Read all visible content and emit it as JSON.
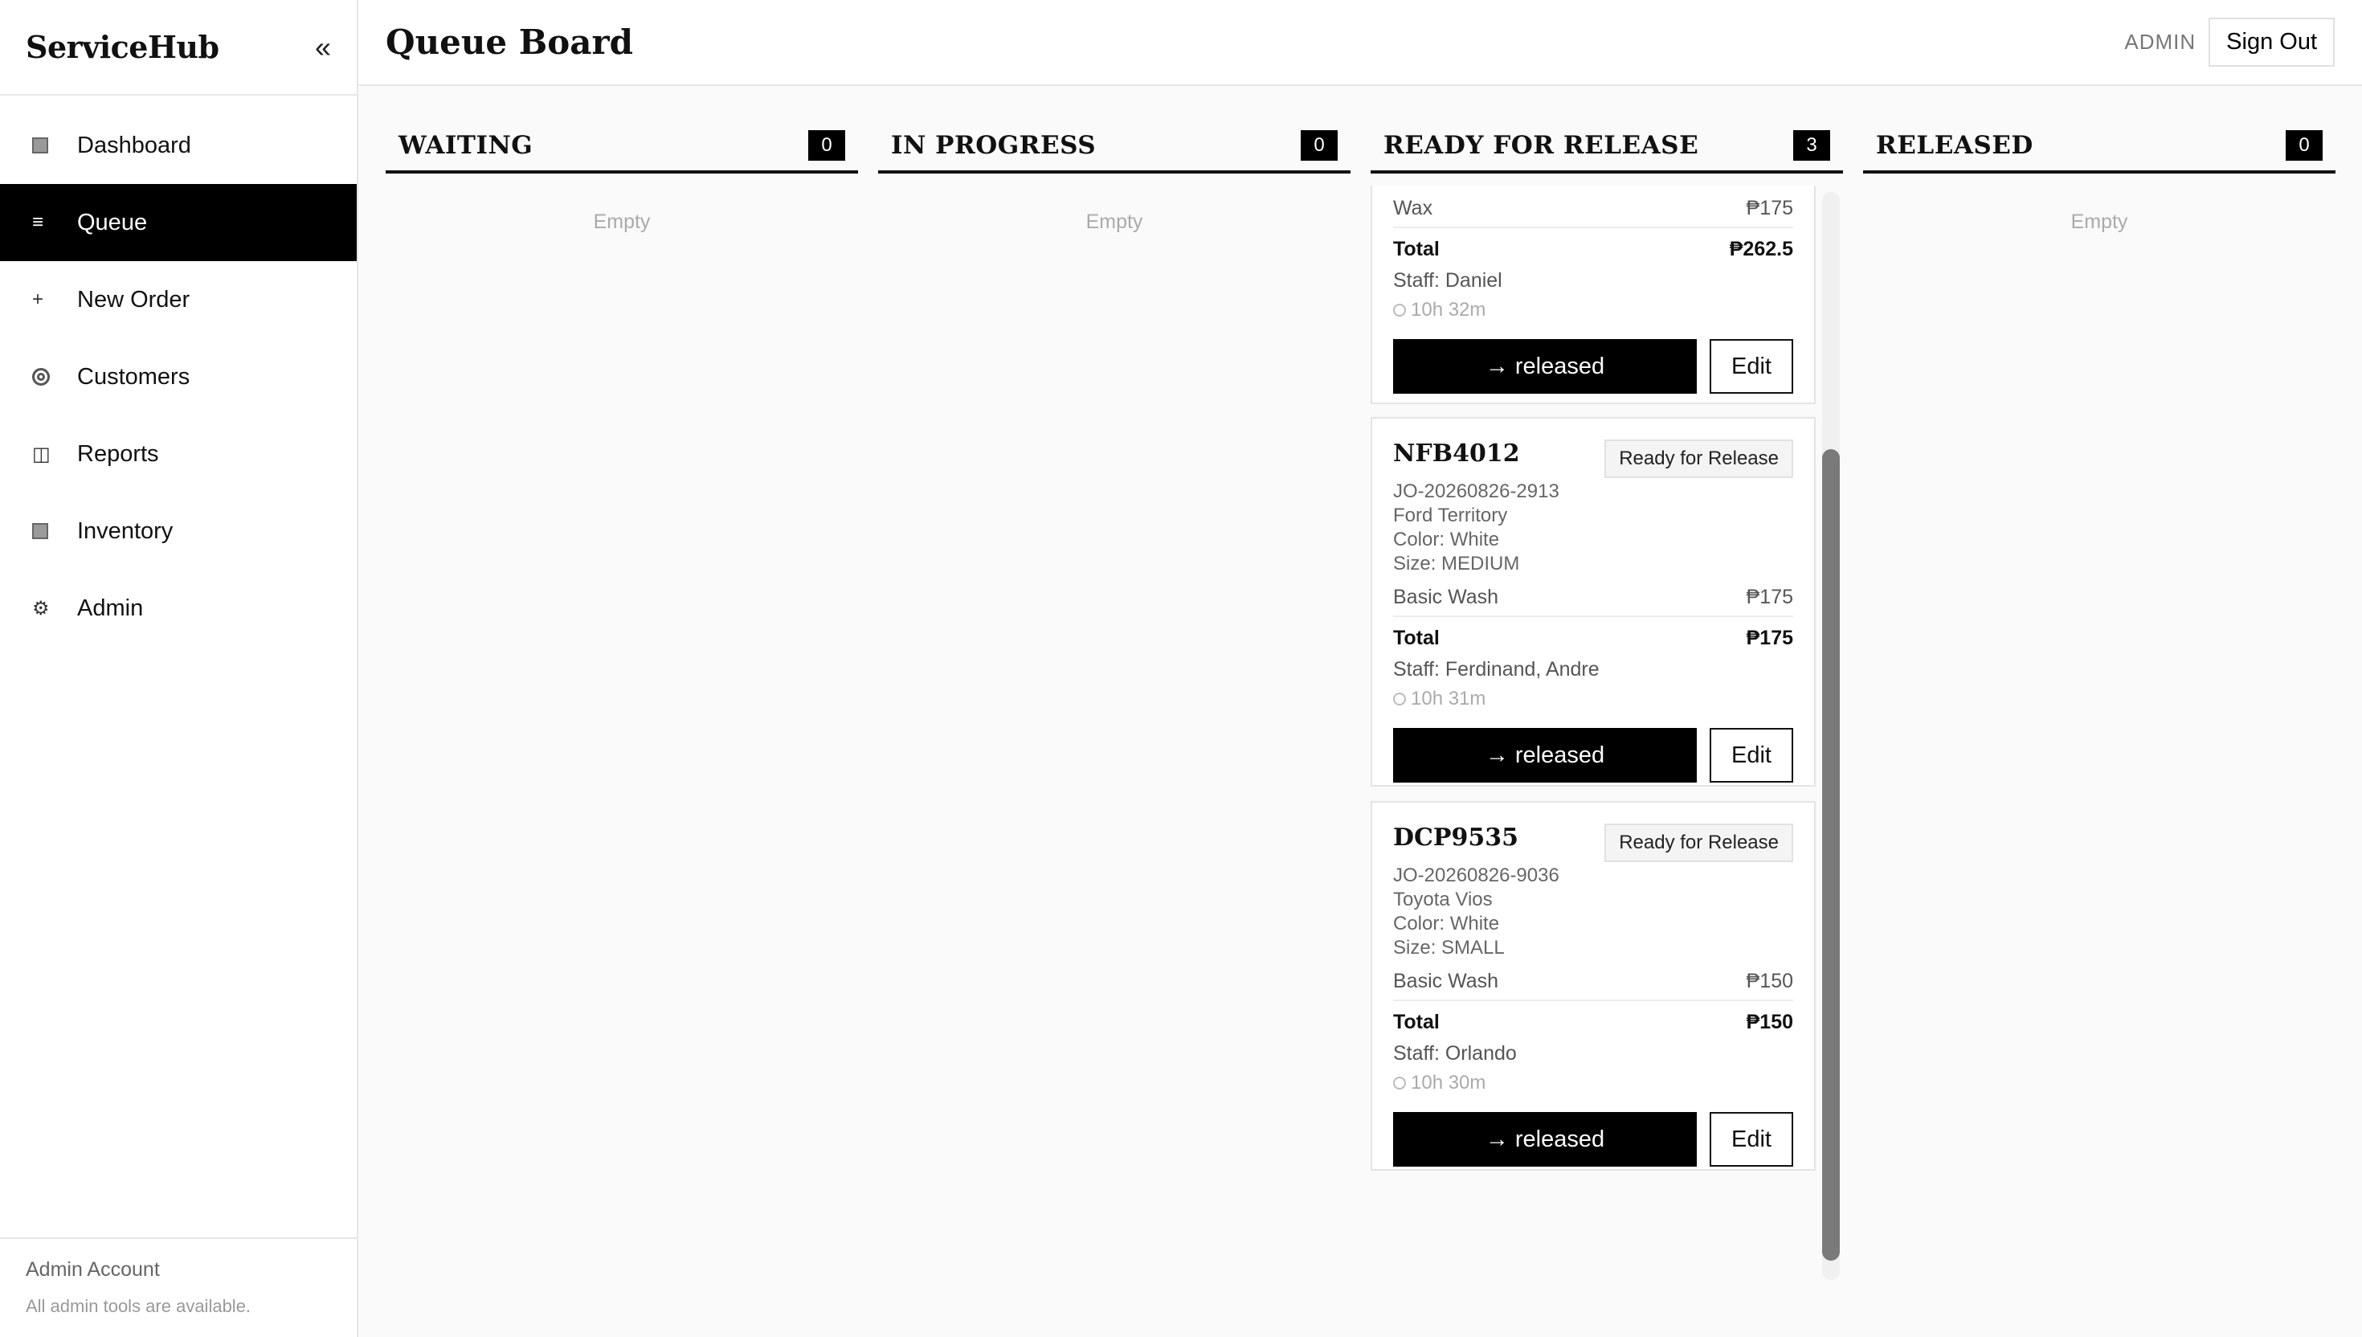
{
  "sidebar": {
    "brand": "ServiceHub",
    "collapse_icon": "«",
    "items": [
      {
        "label": "Dashboard",
        "icon": "dashboard-icon"
      },
      {
        "label": "Queue",
        "icon": "queue-icon",
        "active": true
      },
      {
        "label": "New Order",
        "icon": "plus-icon"
      },
      {
        "label": "Customers",
        "icon": "customers-icon"
      },
      {
        "label": "Reports",
        "icon": "reports-icon"
      },
      {
        "label": "Inventory",
        "icon": "inventory-icon"
      },
      {
        "label": "Admin",
        "icon": "gear-icon"
      }
    ],
    "footer": {
      "title": "Admin Account",
      "subtitle": "All admin tools are available."
    }
  },
  "header": {
    "title": "Queue Board",
    "role": "ADMIN",
    "sign_out": "Sign Out"
  },
  "columns": [
    {
      "title": "WAITING",
      "count": "0",
      "empty": "Empty"
    },
    {
      "title": "IN PROGRESS",
      "count": "0",
      "empty": "Empty"
    },
    {
      "title": "READY FOR RELEASE",
      "count": "3"
    },
    {
      "title": "RELEASED",
      "count": "0",
      "empty": "Empty"
    }
  ],
  "cards": [
    {
      "service": "Wax",
      "service_price": "₱175",
      "total_label": "Total",
      "total": "₱262.5",
      "staff": "Staff: Daniel",
      "elapsed": "10h 32m",
      "release_label": "→ released",
      "edit_label": "Edit"
    },
    {
      "plate": "NFB4012",
      "status": "Ready for Release",
      "job_order": "JO-20260826-2913",
      "vehicle": "Ford Territory",
      "color": "Color: White",
      "size": "Size: MEDIUM",
      "service": "Basic Wash",
      "service_price": "₱175",
      "total_label": "Total",
      "total": "₱175",
      "staff": "Staff: Ferdinand, Andre",
      "elapsed": "10h 31m",
      "release_label": "→ released",
      "edit_label": "Edit"
    },
    {
      "plate": "DCP9535",
      "status": "Ready for Release",
      "job_order": "JO-20260826-9036",
      "vehicle": "Toyota Vios",
      "color": "Color: White",
      "size": "Size: SMALL",
      "service": "Basic Wash",
      "service_price": "₱150",
      "total_label": "Total",
      "total": "₱150",
      "staff": "Staff: Orlando",
      "elapsed": "10h 30m",
      "release_label": "→ released",
      "edit_label": "Edit"
    }
  ]
}
